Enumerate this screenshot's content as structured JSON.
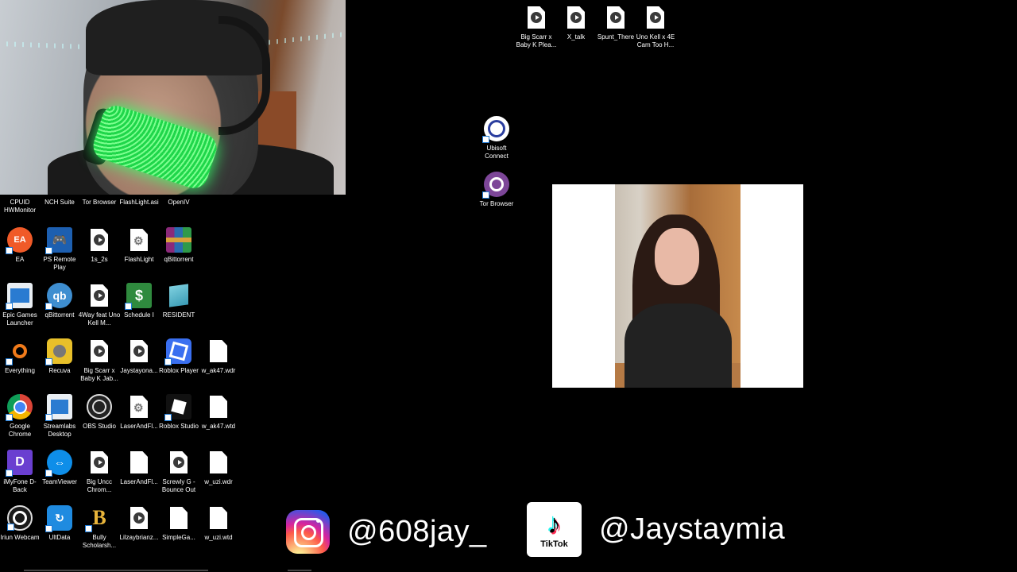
{
  "webcam": {
    "label": ""
  },
  "top_files": [
    {
      "label": "Big Scarr x Baby K Plea...",
      "type": "media"
    },
    {
      "label": "X_talk",
      "type": "media"
    },
    {
      "label": "Spunt_There",
      "type": "media"
    },
    {
      "label": "Uno Kell x 4E Cam Too H...",
      "type": "media"
    }
  ],
  "mid_icons": [
    {
      "label": "Ubisoft Connect",
      "icon": "ubisoft-icon"
    },
    {
      "label": "Tor Browser",
      "icon": "tor-browser-icon"
    }
  ],
  "desktop_rows": [
    [
      {
        "label": "CPUID HWMonitor",
        "icon": "hwmonitor-icon"
      },
      {
        "label": "NCH Suite",
        "icon": "nch-suite-icon"
      },
      {
        "label": "Tor Browser",
        "icon": "tor-browser-icon"
      },
      {
        "label": "FlashLight.asi",
        "icon": "file-icon"
      },
      {
        "label": "OpenIV",
        "icon": "openiv-icon"
      }
    ],
    [
      {
        "label": "EA",
        "icon": "ea-icon"
      },
      {
        "label": "PS Remote Play",
        "icon": "ps-remote-play-icon"
      },
      {
        "label": "1s_2s",
        "icon": "media-file-icon"
      },
      {
        "label": "FlashLight",
        "icon": "settings-file-icon"
      },
      {
        "label": "qBittorrent",
        "icon": "winrar-archive-icon"
      }
    ],
    [
      {
        "label": "Epic Games Launcher",
        "icon": "epic-games-icon"
      },
      {
        "label": "qBittorrent",
        "icon": "qbittorrent-icon"
      },
      {
        "label": "4Way feat Uno Kell M...",
        "icon": "media-file-icon"
      },
      {
        "label": "Schedule I",
        "icon": "schedule-i-icon"
      },
      {
        "label": "RESIDENT",
        "icon": "notepad-icon"
      }
    ],
    [
      {
        "label": "Everything",
        "icon": "everything-search-icon"
      },
      {
        "label": "Recuva",
        "icon": "recuva-icon"
      },
      {
        "label": "Big Scarr x Baby K Jab...",
        "icon": "media-file-icon"
      },
      {
        "label": "Jaystayona...",
        "icon": "media-file-icon"
      },
      {
        "label": "Roblox Player",
        "icon": "roblox-player-icon"
      },
      {
        "label": "w_ak47.wdr",
        "icon": "file-icon"
      }
    ],
    [
      {
        "label": "Google Chrome",
        "icon": "chrome-icon"
      },
      {
        "label": "Streamlabs Desktop",
        "icon": "streamlabs-icon"
      },
      {
        "label": "OBS Studio",
        "icon": "obs-studio-icon"
      },
      {
        "label": "LaserAndFl...",
        "icon": "settings-file-icon"
      },
      {
        "label": "Roblox Studio",
        "icon": "roblox-studio-icon"
      },
      {
        "label": "w_ak47.wtd",
        "icon": "file-icon"
      }
    ],
    [
      {
        "label": "iMyFone D-Back",
        "icon": "imyfone-icon"
      },
      {
        "label": "TeamViewer",
        "icon": "teamviewer-icon"
      },
      {
        "label": "Big Uncc Chrom...",
        "icon": "media-file-icon"
      },
      {
        "label": "LaserAndFl...",
        "icon": "file-icon"
      },
      {
        "label": "Screwly G - Bounce Out",
        "icon": "media-file-icon"
      },
      {
        "label": "w_uzi.wdr",
        "icon": "file-icon"
      }
    ],
    [
      {
        "label": "Iriun Webcam",
        "icon": "iriun-webcam-icon"
      },
      {
        "label": "UltData",
        "icon": "ultdata-icon"
      },
      {
        "label": "Bully Scholarsh...",
        "icon": "bully-icon"
      },
      {
        "label": "Lilzaybrianz...",
        "icon": "media-file-icon"
      },
      {
        "label": "SimpleGa...",
        "icon": "file-icon"
      },
      {
        "label": "w_uzi.wtd",
        "icon": "file-icon"
      }
    ]
  ],
  "social": {
    "instagram_handle": "@608jay_",
    "tiktok_word": "TikTok",
    "tiktok_handle": "@Jaystaymia"
  }
}
